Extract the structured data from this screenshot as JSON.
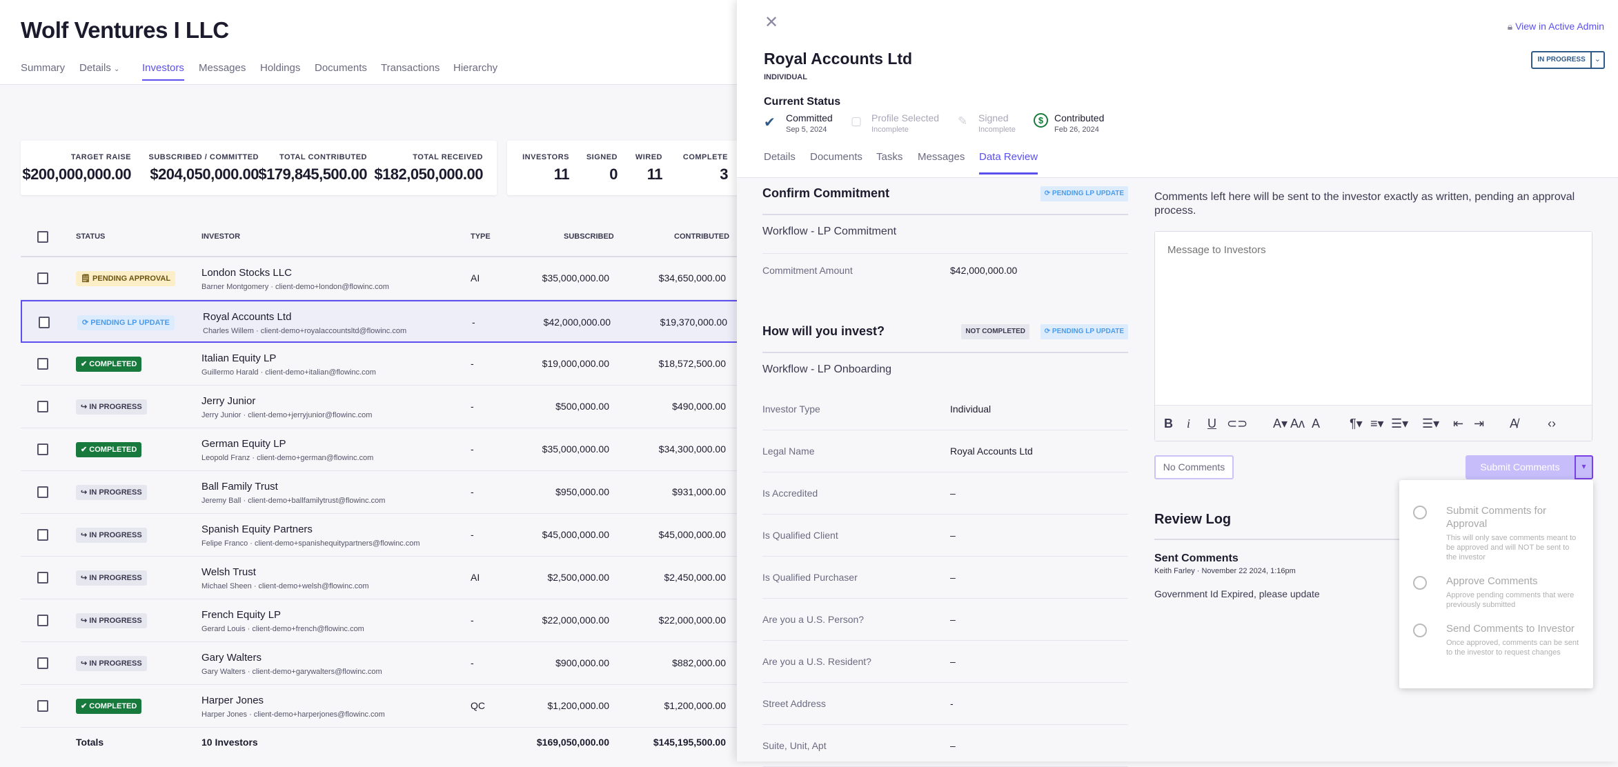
{
  "page": {
    "title": "Wolf Ventures I LLC",
    "tabs": [
      "Summary",
      "Details",
      "Investors",
      "Messages",
      "Holdings",
      "Documents",
      "Transactions",
      "Hierarchy"
    ],
    "active_tab": "Investors"
  },
  "stats": [
    {
      "label": "TARGET RAISE",
      "value": "$200,000,000.00"
    },
    {
      "label": "SUBSCRIBED / COMMITTED",
      "value": "$204,050,000.00"
    },
    {
      "label": "TOTAL CONTRIBUTED",
      "value": "$179,845,500.00"
    },
    {
      "label": "TOTAL RECEIVED",
      "value": "$182,050,000.00"
    }
  ],
  "counts": [
    {
      "label": "INVESTORS",
      "value": "11"
    },
    {
      "label": "SIGNED",
      "value": "0"
    },
    {
      "label": "WIRED",
      "value": "11"
    },
    {
      "label": "COMPLETE",
      "value": "3"
    }
  ],
  "table": {
    "headers": {
      "status": "STATUS",
      "investor": "INVESTOR",
      "type": "TYPE",
      "subscribed": "SUBSCRIBED",
      "contributed": "CONTRIBUTED"
    },
    "rows": [
      {
        "status": "PENDING APPROVAL",
        "kind": "approval",
        "name": "London Stocks LLC",
        "sub": "Barner Montgomery · client-demo+london@flowinc.com",
        "type": "AI",
        "subscribed": "$35,000,000.00",
        "contributed": "$34,650,000.00"
      },
      {
        "status": "PENDING LP UPDATE",
        "kind": "lp",
        "name": "Royal Accounts Ltd",
        "sub": "Charles Willem · client-demo+royalaccountsltd@flowinc.com",
        "type": "-",
        "subscribed": "$42,000,000.00",
        "contributed": "$19,370,000.00",
        "selected": true
      },
      {
        "status": "COMPLETED",
        "kind": "done",
        "name": "Italian Equity LP",
        "sub": "Guillermo Harald · client-demo+italian@flowinc.com",
        "type": "-",
        "subscribed": "$19,000,000.00",
        "contributed": "$18,572,500.00"
      },
      {
        "status": "IN PROGRESS",
        "kind": "prog",
        "name": "Jerry Junior",
        "sub": "Jerry Junior · client-demo+jerryjunior@flowinc.com",
        "type": "-",
        "subscribed": "$500,000.00",
        "contributed": "$490,000.00"
      },
      {
        "status": "COMPLETED",
        "kind": "done",
        "name": "German Equity LP",
        "sub": "Leopold Franz · client-demo+german@flowinc.com",
        "type": "-",
        "subscribed": "$35,000,000.00",
        "contributed": "$34,300,000.00"
      },
      {
        "status": "IN PROGRESS",
        "kind": "prog",
        "name": "Ball Family Trust",
        "sub": "Jeremy Ball · client-demo+ballfamilytrust@flowinc.com",
        "type": "-",
        "subscribed": "$950,000.00",
        "contributed": "$931,000.00"
      },
      {
        "status": "IN PROGRESS",
        "kind": "prog",
        "name": "Spanish Equity Partners",
        "sub": "Felipe Franco · client-demo+spanishequitypartners@flowinc.com",
        "type": "-",
        "subscribed": "$45,000,000.00",
        "contributed": "$45,000,000.00"
      },
      {
        "status": "IN PROGRESS",
        "kind": "prog",
        "name": "Welsh Trust",
        "sub": "Michael Sheen · client-demo+welsh@flowinc.com",
        "type": "AI",
        "subscribed": "$2,500,000.00",
        "contributed": "$2,450,000.00"
      },
      {
        "status": "IN PROGRESS",
        "kind": "prog",
        "name": "French Equity LP",
        "sub": "Gerard Louis · client-demo+french@flowinc.com",
        "type": "-",
        "subscribed": "$22,000,000.00",
        "contributed": "$22,000,000.00"
      },
      {
        "status": "IN PROGRESS",
        "kind": "prog",
        "name": "Gary Walters",
        "sub": "Gary Walters · client-demo+garywalters@flowinc.com",
        "type": "-",
        "subscribed": "$900,000.00",
        "contributed": "$882,000.00"
      },
      {
        "status": "COMPLETED",
        "kind": "done",
        "name": "Harper Jones",
        "sub": "Harper Jones · client-demo+harperjones@flowinc.com",
        "type": "QC",
        "subscribed": "$1,200,000.00",
        "contributed": "$1,200,000.00"
      }
    ],
    "totals": {
      "label": "Totals",
      "investors": "10 Investors",
      "subscribed": "$169,050,000.00",
      "contributed": "$145,195,500.00"
    }
  },
  "drawer": {
    "admin_link": "View in Active Admin",
    "name": "Royal Accounts Ltd",
    "type": "INDIVIDUAL",
    "status_button": "IN PROGRESS",
    "current_status": "Current Status",
    "steps": [
      {
        "name": "Committed",
        "detail": "Sep 5, 2024"
      },
      {
        "name": "Profile Selected",
        "detail": "Incomplete"
      },
      {
        "name": "Signed",
        "detail": "Incomplete"
      },
      {
        "name": "Contributed",
        "detail": "Feb 26, 2024"
      }
    ],
    "tabs": [
      "Details",
      "Documents",
      "Tasks",
      "Messages",
      "Data Review"
    ],
    "active_tab": "Data Review",
    "confirm": {
      "title": "Confirm Commitment",
      "badge": "PENDING LP UPDATE",
      "workflow": "Workflow - LP Commitment",
      "field": "Commitment Amount",
      "value": "$42,000,000.00"
    },
    "invest": {
      "title": "How will you invest?",
      "badge1": "NOT COMPLETED",
      "badge2": "PENDING LP UPDATE",
      "workflow": "Workflow - LP Onboarding",
      "fields": [
        {
          "k": "Investor Type",
          "v": "Individual"
        },
        {
          "k": "Legal Name",
          "v": "Royal Accounts Ltd"
        },
        {
          "k": "Is Accredited",
          "v": "–"
        },
        {
          "k": "Is Qualified Client",
          "v": "–"
        },
        {
          "k": "Is Qualified Purchaser",
          "v": "–"
        },
        {
          "k": "Are you a U.S. Person?",
          "v": "–"
        },
        {
          "k": "Are you a U.S. Resident?",
          "v": "–"
        },
        {
          "k": "Street Address",
          "v": "-"
        },
        {
          "k": "Suite, Unit, Apt",
          "v": "–"
        }
      ]
    },
    "comments": {
      "intro": "Comments left here will be sent to the investor exactly as written, pending an approval process.",
      "placeholder": "Message to Investors",
      "no_comments": "No Comments",
      "submit": "Submit Comments",
      "options": [
        {
          "title": "Submit Comments for Approval",
          "desc": "This will only save comments meant to be approved and will NOT be sent to the investor"
        },
        {
          "title": "Approve Comments",
          "desc": "Approve pending comments that were previously submitted"
        },
        {
          "title": "Send Comments to Investor",
          "desc": "Once approved, comments can be sent to the investor to request changes"
        }
      ]
    },
    "review_log": {
      "title": "Review Log",
      "entry_title": "Sent Comments",
      "entry_meta": "Keith Farley · November 22 2024, 1:16pm",
      "entry_body": "Government Id Expired, please update"
    }
  },
  "colors": {
    "accent": "#5b4ff0",
    "completed": "#177a3c",
    "pending_approval": "#fcefc8",
    "pending_lp": "#dcecfd"
  }
}
